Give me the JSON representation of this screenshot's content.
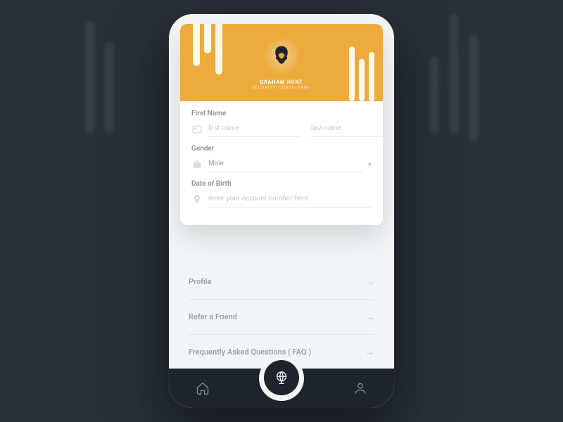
{
  "banner": {
    "name": "GRAHAM HUNT",
    "subtitle": "SECURITY CONSULTANT"
  },
  "form": {
    "firstName": {
      "label": "First Name",
      "placeholder_first": "first name",
      "placeholder_last": "last name"
    },
    "gender": {
      "label": "Gender",
      "value": "Male"
    },
    "dob": {
      "label": "Date of Birth",
      "placeholder": "enter your account number here"
    }
  },
  "links": [
    {
      "label": "Profile"
    },
    {
      "label": "Refer a Friend"
    },
    {
      "label": "Frequently Asked Questions ( FAQ )"
    }
  ],
  "icons": {
    "arrow": "→"
  }
}
